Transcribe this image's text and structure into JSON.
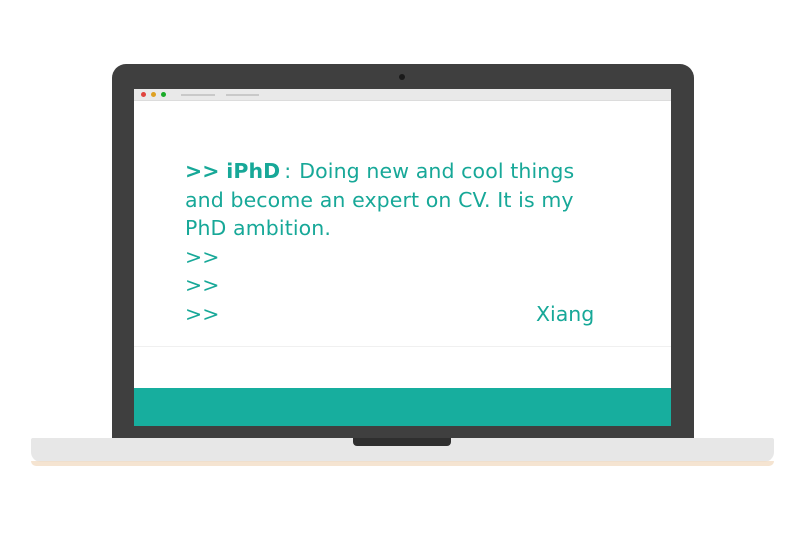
{
  "window": {
    "controls": [
      "close-dot",
      "minimize-dot",
      "maximize-dot"
    ],
    "colors": {
      "close": "#e0443e",
      "minimize": "#dea123",
      "maximize": "#1aab29"
    }
  },
  "message": {
    "prompt": ">>",
    "name": "iPhD",
    "separator": ":",
    "line1": "Doing new and cool things",
    "line2": "and become an expert on CV. It is my",
    "line3": "PhD ambition.",
    "empty_prompts": [
      ">>",
      ">>",
      ">>"
    ],
    "signature": "Xiang"
  },
  "theme": {
    "accent": "#17a898",
    "footer": "#17ae9e",
    "bezel": "#3f3f3f"
  }
}
